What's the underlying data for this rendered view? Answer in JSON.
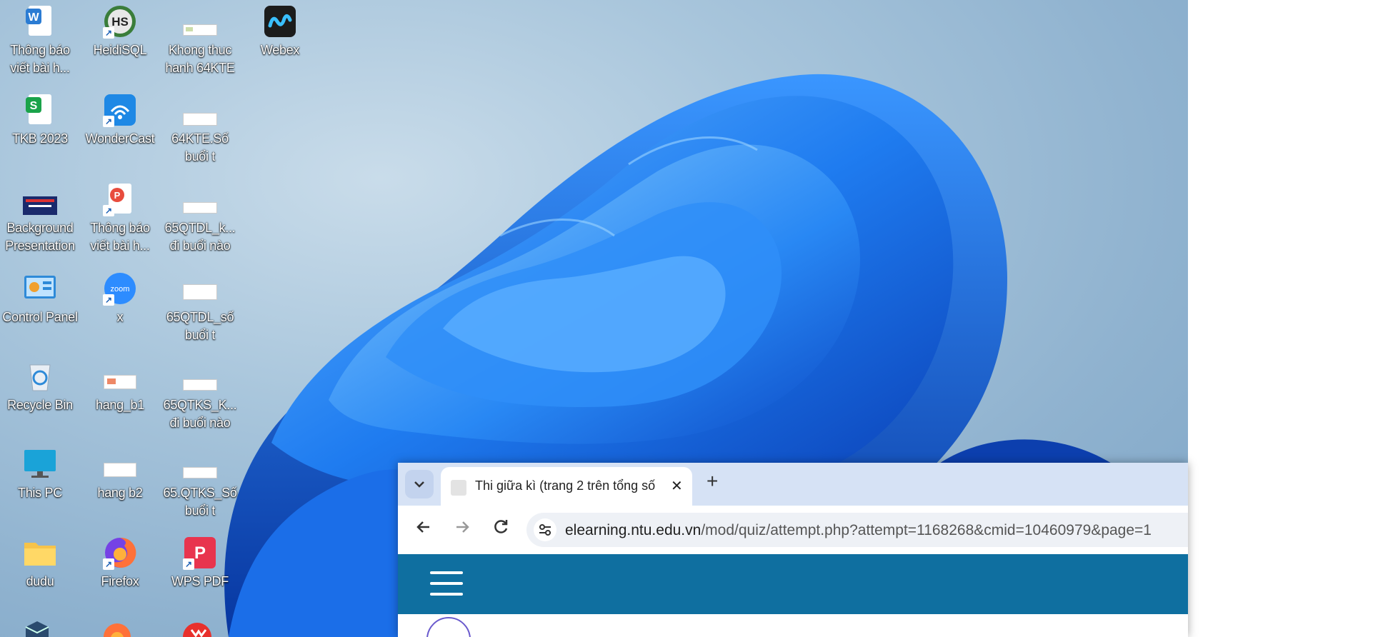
{
  "desktop": {
    "icons": [
      {
        "label": "Thông báo viết bài h...",
        "icon": "word-doc-icon",
        "color": "#2b7cd3"
      },
      {
        "label": "TKB 2023",
        "icon": "spreadsheet-icon",
        "color": "#1aa34a"
      },
      {
        "label": "Background Presentation",
        "icon": "image-thumbnail-icon",
        "color": "#1a2a6c"
      },
      {
        "label": "Control Panel",
        "icon": "control-panel-icon",
        "color": "#2e8ad8"
      },
      {
        "label": "Recycle Bin",
        "icon": "recycle-bin-icon",
        "color": "#2e8ad8"
      },
      {
        "label": "This PC",
        "icon": "monitor-icon",
        "color": "#1aa3d8"
      },
      {
        "label": "dudu",
        "icon": "folder-icon",
        "color": "#f6c34a"
      },
      {
        "label": "HeidiSQL",
        "icon": "heidisql-icon",
        "color": "#3a7d3a"
      },
      {
        "label": "WonderCast",
        "icon": "wondercast-icon",
        "color": "#1e88e5"
      },
      {
        "label": "Thông báo viết bài h...",
        "icon": "pdf-doc-icon",
        "color": "#e84c3d"
      },
      {
        "label": "x",
        "icon": "zoom-icon",
        "color": "#2d8cff"
      },
      {
        "label": "hang_b1",
        "icon": "document-thumbnail-icon",
        "color": "#ffffff"
      },
      {
        "label": "hang b2",
        "icon": "document-thumbnail-icon",
        "color": "#ffffff"
      },
      {
        "label": "Firefox",
        "icon": "firefox-icon",
        "color": "#ff7139"
      },
      {
        "label": "Khong thuc hanh 64KTE",
        "icon": "document-thumbnail-icon",
        "color": "#ffffff"
      },
      {
        "label": "64KTE.Số buổi t",
        "icon": "document-thumbnail-icon",
        "color": "#ffffff"
      },
      {
        "label": "65QTDL_k... đi buổi nào",
        "icon": "document-thumbnail-icon",
        "color": "#ffffff"
      },
      {
        "label": "65QTDL_số buổi t",
        "icon": "document-thumbnail-icon",
        "color": "#ffffff"
      },
      {
        "label": "65QTKS_K... đi buổi nào",
        "icon": "document-thumbnail-icon",
        "color": "#ffffff"
      },
      {
        "label": "65.QTKS_Số buổi t",
        "icon": "document-thumbnail-icon",
        "color": "#ffffff"
      },
      {
        "label": "WPS PDF",
        "icon": "wps-pdf-icon",
        "color": "#e8344e"
      },
      {
        "label": "Webex",
        "icon": "webex-icon",
        "color": "#1c1c1c"
      }
    ]
  },
  "browser": {
    "tab_title": "Thi giữa kì (trang 2 trên tổng số",
    "new_tab_glyph": "+",
    "close_glyph": "✕",
    "url_host": "elearning.ntu.edu.vn",
    "url_path": "/mod/quiz/attempt.php?attempt=1168268&cmid=10460979&page=1",
    "site_header_color": "#0f6fa0"
  }
}
